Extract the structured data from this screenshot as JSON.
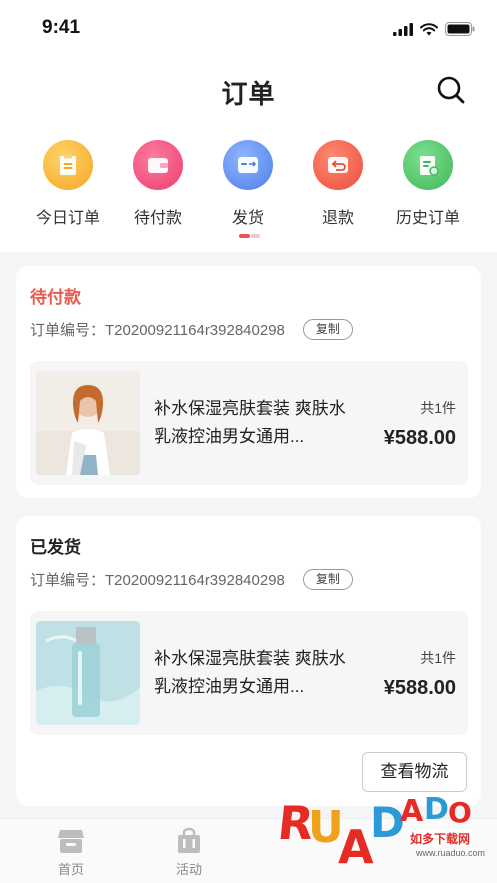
{
  "status_bar": {
    "time": "9:41"
  },
  "header": {
    "title": "订单"
  },
  "categories": [
    {
      "label": "今日订单",
      "icon": "today-order-icon",
      "color": "#f7b733"
    },
    {
      "label": "待付款",
      "icon": "wallet-icon",
      "color": "#f04e78"
    },
    {
      "label": "发货",
      "icon": "shipping-icon",
      "color": "#5a8ff0"
    },
    {
      "label": "退款",
      "icon": "refund-icon",
      "color": "#f0604b"
    },
    {
      "label": "历史订单",
      "icon": "history-order-icon",
      "color": "#4cc76a"
    }
  ],
  "orders": [
    {
      "status": "待付款",
      "order_no": "订单编号：T20200921164r392840298",
      "copy_label": "复制",
      "product_name": "补水保湿亮肤套装 爽肤水乳液控油男女通用...",
      "quantity": "共1件",
      "price": "¥588.00"
    },
    {
      "status": "已发货",
      "order_no": "订单编号：T20200921164r392840298",
      "copy_label": "复制",
      "product_name": "补水保湿亮肤套装 爽肤水乳液控油男女通用...",
      "quantity": "共1件",
      "price": "¥588.00",
      "action_label": "查看物流"
    }
  ],
  "tabbar": [
    {
      "label": "首页",
      "icon": "home-store-icon"
    },
    {
      "label": "活动",
      "icon": "activity-bag-icon"
    }
  ],
  "watermark": {
    "brand": "RUANDAO",
    "sub": "如多下载网",
    "url": "www.ruaduo.com"
  },
  "colors": {
    "accent": "#f0524e",
    "pending": "#e85a4f"
  }
}
